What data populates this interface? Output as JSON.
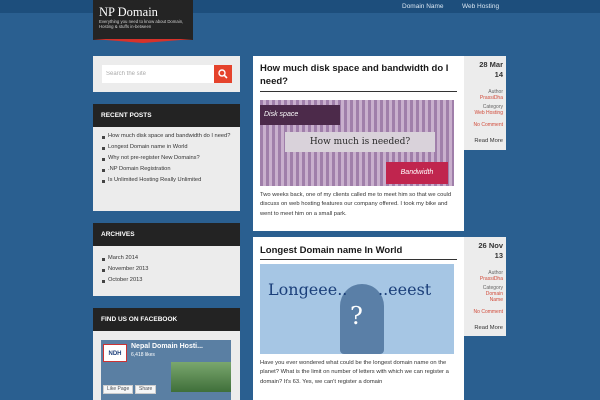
{
  "header": {
    "site_title": "NP Domain",
    "tagline": "Everything you need to know about Domain, Hosting & stuffs in-between",
    "nav": [
      "Domain Name",
      "Web Hosting"
    ]
  },
  "search": {
    "placeholder": "Search the site"
  },
  "recent_posts": {
    "title": "RECENT POSTS",
    "items": [
      "How much disk space and bandwidth do I need?",
      "Longest Domain name in World",
      "Why not pre-register New Domains?",
      ".NP Domain Registration",
      "Is Unlimited Hosting Really Unlimited"
    ]
  },
  "archives": {
    "title": "ARCHIVES",
    "items": [
      "March 2014",
      "November 2013",
      "October 2013"
    ]
  },
  "facebook": {
    "title": "FIND US ON FACEBOOK",
    "page_name": "Nepal Domain Hosti...",
    "likes": "6,418 likes",
    "logo_text": "NDH",
    "like_button": "Like Page",
    "share_button": "Share"
  },
  "posts": [
    {
      "title": "How much disk space and bandwidth do I need?",
      "day": "28 Mar",
      "year": "14",
      "author_label": "Author",
      "author": "PrassiDha",
      "category_label": "Category",
      "category": "Web Hosting",
      "comments": "No Comment",
      "read_more": "Read More",
      "image_text": {
        "top": "Disk space",
        "middle": "How much is needed?",
        "bottom": "Bandwidth"
      },
      "excerpt": "Two weeks back, one of my clients called me to meet him so that we could discuss on web hosting features our company offered. I took my bike and went to meet him on a small park."
    },
    {
      "title": "Longest Domain name In World",
      "day": "26 Nov",
      "year": "13",
      "author_label": "Author",
      "author": "PrassiDha",
      "category_label": "Category",
      "category": "Domain Name",
      "comments": "No Comment",
      "read_more": "Read More",
      "image_text": {
        "left": "Longeee..",
        "right": "..eeest",
        "mark": "?"
      },
      "excerpt": "Have you ever wondered what could be the longest domain name on the planet? What is the limit on number of letters with which we can register a domain? It's 63. Yes, we can't register a domain"
    }
  ]
}
